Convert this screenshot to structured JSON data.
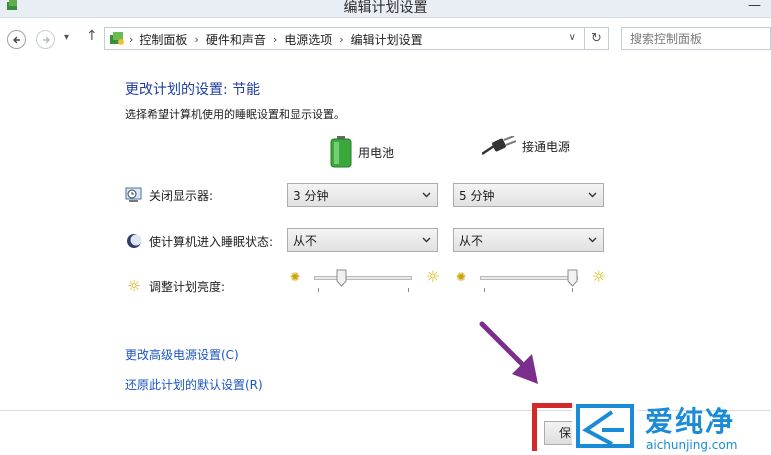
{
  "window": {
    "title": "编辑计划设置",
    "minimize_glyph": "—"
  },
  "nav": {
    "back_icon": "back-arrow-icon",
    "forward_icon": "forward-arrow-icon",
    "recent_glyph": "▾",
    "up_glyph": "↑",
    "breadcrumb": [
      "控制面板",
      "硬件和声音",
      "电源选项",
      "编辑计划设置"
    ],
    "crumb_separator": "›",
    "dropdown_glyph": "∨",
    "refresh_glyph": "↻",
    "search_placeholder": "搜索控制面板"
  },
  "main": {
    "heading": "更改计划的设置: 节能",
    "subheading": "选择希望计算机使用的睡眠设置和显示设置。",
    "columns": {
      "battery": "用电池",
      "plugged": "接通电源"
    },
    "rows": {
      "display": {
        "label": "关闭显示器:",
        "battery_value": "3 分钟",
        "plugged_value": "5 分钟"
      },
      "sleep": {
        "label": "使计算机进入睡眠状态:",
        "battery_value": "从不",
        "plugged_value": "从不"
      },
      "brightness": {
        "label": "调整计划亮度:",
        "battery_level": 0.25,
        "plugged_level": 1.0
      }
    },
    "links": {
      "advanced": "更改高级电源设置(C)",
      "restore": "还原此计划的默认设置(R)"
    },
    "save_button": "保"
  },
  "watermark": {
    "text": "爱纯净",
    "domain": "aichunjing.com",
    "frame_color": "#d22a2a",
    "text_color": "#1a8bd6"
  },
  "colors": {
    "heading": "#1f3d9c",
    "link": "#1a56c2",
    "arrow": "#7b2e8c"
  }
}
